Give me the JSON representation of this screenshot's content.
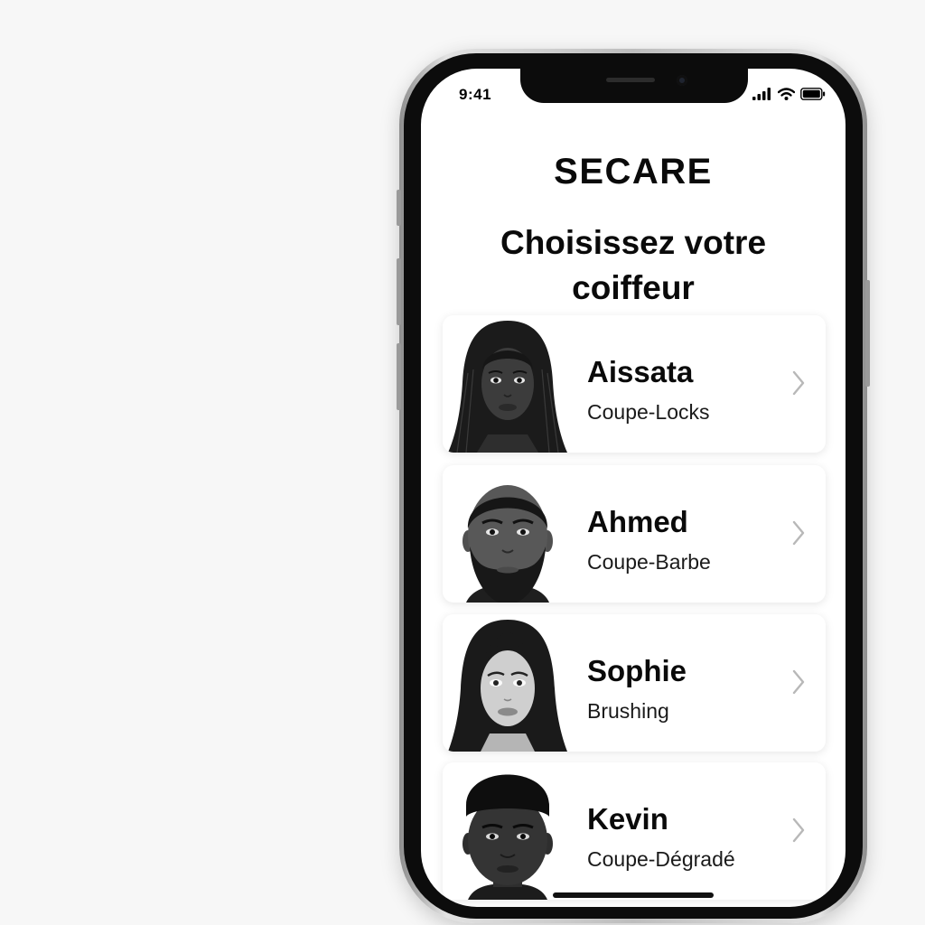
{
  "status_bar": {
    "time": "9:41"
  },
  "app": {
    "title": "SECARE",
    "heading": "Choisissez votre coiffeur"
  },
  "stylists": [
    {
      "name": "Aissata",
      "service": "Coupe-Locks"
    },
    {
      "name": "Ahmed",
      "service": "Coupe-Barbe"
    },
    {
      "name": "Sophie",
      "service": "Brushing"
    },
    {
      "name": "Kevin",
      "service": "Coupe-Dégradé"
    }
  ],
  "colors": {
    "background": "#ffffff",
    "text": "#0a0a0a",
    "chevron": "#b8b8b8",
    "frame": "#0c0c0c"
  },
  "icons": [
    "signal-icon",
    "wifi-icon",
    "battery-icon",
    "chevron-right-icon"
  ]
}
